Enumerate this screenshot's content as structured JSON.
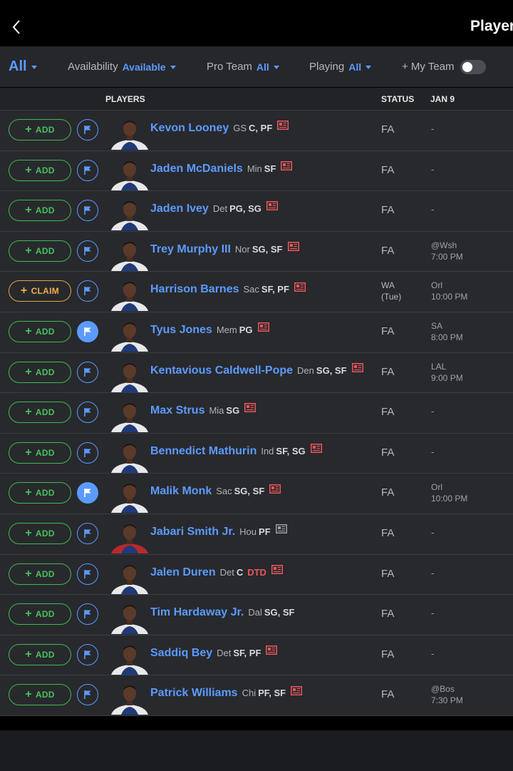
{
  "header": {
    "title": "Player"
  },
  "filters": {
    "all": "All",
    "availability": {
      "label": "Availability",
      "value": "Available"
    },
    "pro_team": {
      "label": "Pro Team",
      "value": "All"
    },
    "playing": {
      "label": "Playing",
      "value": "All"
    },
    "my_team": {
      "label": "+ My Team",
      "toggle_on": false
    }
  },
  "columns": {
    "players": "PLAYERS",
    "status": "STATUS",
    "date": "JAN 9"
  },
  "colors": {
    "accent": "#5b9bff",
    "add": "#3fb950",
    "claim": "#f0ad4e",
    "dtd": "#e8575a"
  },
  "rows": [
    {
      "action": "ADD",
      "flag_active": false,
      "name": "Kevon Looney",
      "team": "GS",
      "pos": "C, PF",
      "injury": "",
      "news": "red",
      "status": "FA",
      "game_line1": "-",
      "game_line2": ""
    },
    {
      "action": "ADD",
      "flag_active": false,
      "name": "Jaden McDaniels",
      "team": "Min",
      "pos": "SF",
      "injury": "",
      "news": "red",
      "status": "FA",
      "game_line1": "-",
      "game_line2": ""
    },
    {
      "action": "ADD",
      "flag_active": false,
      "name": "Jaden Ivey",
      "team": "Det",
      "pos": "PG, SG",
      "injury": "",
      "news": "red",
      "status": "FA",
      "game_line1": "-",
      "game_line2": ""
    },
    {
      "action": "ADD",
      "flag_active": false,
      "name": "Trey Murphy III",
      "team": "Nor",
      "pos": "SG, SF",
      "injury": "",
      "news": "red",
      "status": "FA",
      "game_line1": "@Wsh",
      "game_line2": "7:00 PM"
    },
    {
      "action": "CLAIM",
      "flag_active": false,
      "name": "Harrison Barnes",
      "team": "Sac",
      "pos": "SF, PF",
      "injury": "",
      "news": "red",
      "status": "WA",
      "status_line2": "(Tue)",
      "game_line1": "Orl",
      "game_line2": "10:00 PM"
    },
    {
      "action": "ADD",
      "flag_active": true,
      "name": "Tyus Jones",
      "team": "Mem",
      "pos": "PG",
      "injury": "",
      "news": "red",
      "status": "FA",
      "game_line1": "SA",
      "game_line2": "8:00 PM"
    },
    {
      "action": "ADD",
      "flag_active": false,
      "name": "Kentavious Caldwell-Pope",
      "team": "Den",
      "pos": "SG, SF",
      "injury": "",
      "news": "red",
      "status": "FA",
      "game_line1": "LAL",
      "game_line2": "9:00 PM"
    },
    {
      "action": "ADD",
      "flag_active": false,
      "name": "Max Strus",
      "team": "Mia",
      "pos": "SG",
      "injury": "",
      "news": "red",
      "status": "FA",
      "game_line1": "-",
      "game_line2": ""
    },
    {
      "action": "ADD",
      "flag_active": false,
      "name": "Bennedict Mathurin",
      "team": "Ind",
      "pos": "SF, SG",
      "injury": "",
      "news": "red",
      "status": "FA",
      "game_line1": "-",
      "game_line2": ""
    },
    {
      "action": "ADD",
      "flag_active": true,
      "name": "Malik Monk",
      "team": "Sac",
      "pos": "SG, SF",
      "injury": "",
      "news": "red",
      "status": "FA",
      "game_line1": "Orl",
      "game_line2": "10:00 PM"
    },
    {
      "action": "ADD",
      "flag_active": false,
      "name": "Jabari Smith Jr.",
      "team": "Hou",
      "pos": "PF",
      "injury": "",
      "news": "gray",
      "status": "FA",
      "game_line1": "-",
      "game_line2": ""
    },
    {
      "action": "ADD",
      "flag_active": false,
      "name": "Jalen Duren",
      "team": "Det",
      "pos": "C",
      "injury": "DTD",
      "news": "red",
      "status": "FA",
      "game_line1": "-",
      "game_line2": ""
    },
    {
      "action": "ADD",
      "flag_active": false,
      "name": "Tim Hardaway Jr.",
      "team": "Dal",
      "pos": "SG, SF",
      "injury": "",
      "news": "",
      "status": "FA",
      "game_line1": "-",
      "game_line2": ""
    },
    {
      "action": "ADD",
      "flag_active": false,
      "name": "Saddiq Bey",
      "team": "Det",
      "pos": "SF, PF",
      "injury": "",
      "news": "red",
      "status": "FA",
      "game_line1": "-",
      "game_line2": ""
    },
    {
      "action": "ADD",
      "flag_active": false,
      "name": "Patrick Williams",
      "team": "Chi",
      "pos": "PF, SF",
      "injury": "",
      "news": "red",
      "status": "FA",
      "game_line1": "@Bos",
      "game_line2": "7:30 PM"
    }
  ]
}
